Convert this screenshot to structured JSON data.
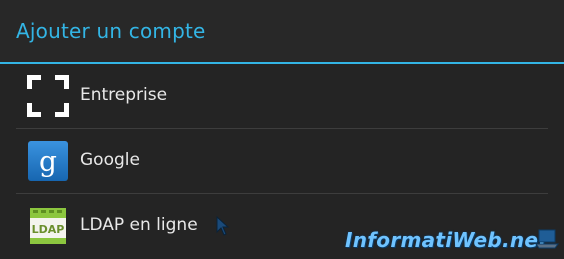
{
  "dialog": {
    "title": "Ajouter un compte"
  },
  "accounts": [
    {
      "label": "Entreprise",
      "icon": "corporate-frame-icon"
    },
    {
      "label": "Google",
      "icon": "google-g-icon"
    },
    {
      "label": "LDAP en ligne",
      "icon": "ldap-icon",
      "icon_text": "LDAP"
    }
  ],
  "watermark": {
    "text": "InformatiWeb.net"
  },
  "colors": {
    "accent": "#33b5e5",
    "background": "#242424",
    "text": "#e8e8e8",
    "google_blue": "#1c78c6",
    "ldap_green": "#8cc63f"
  }
}
